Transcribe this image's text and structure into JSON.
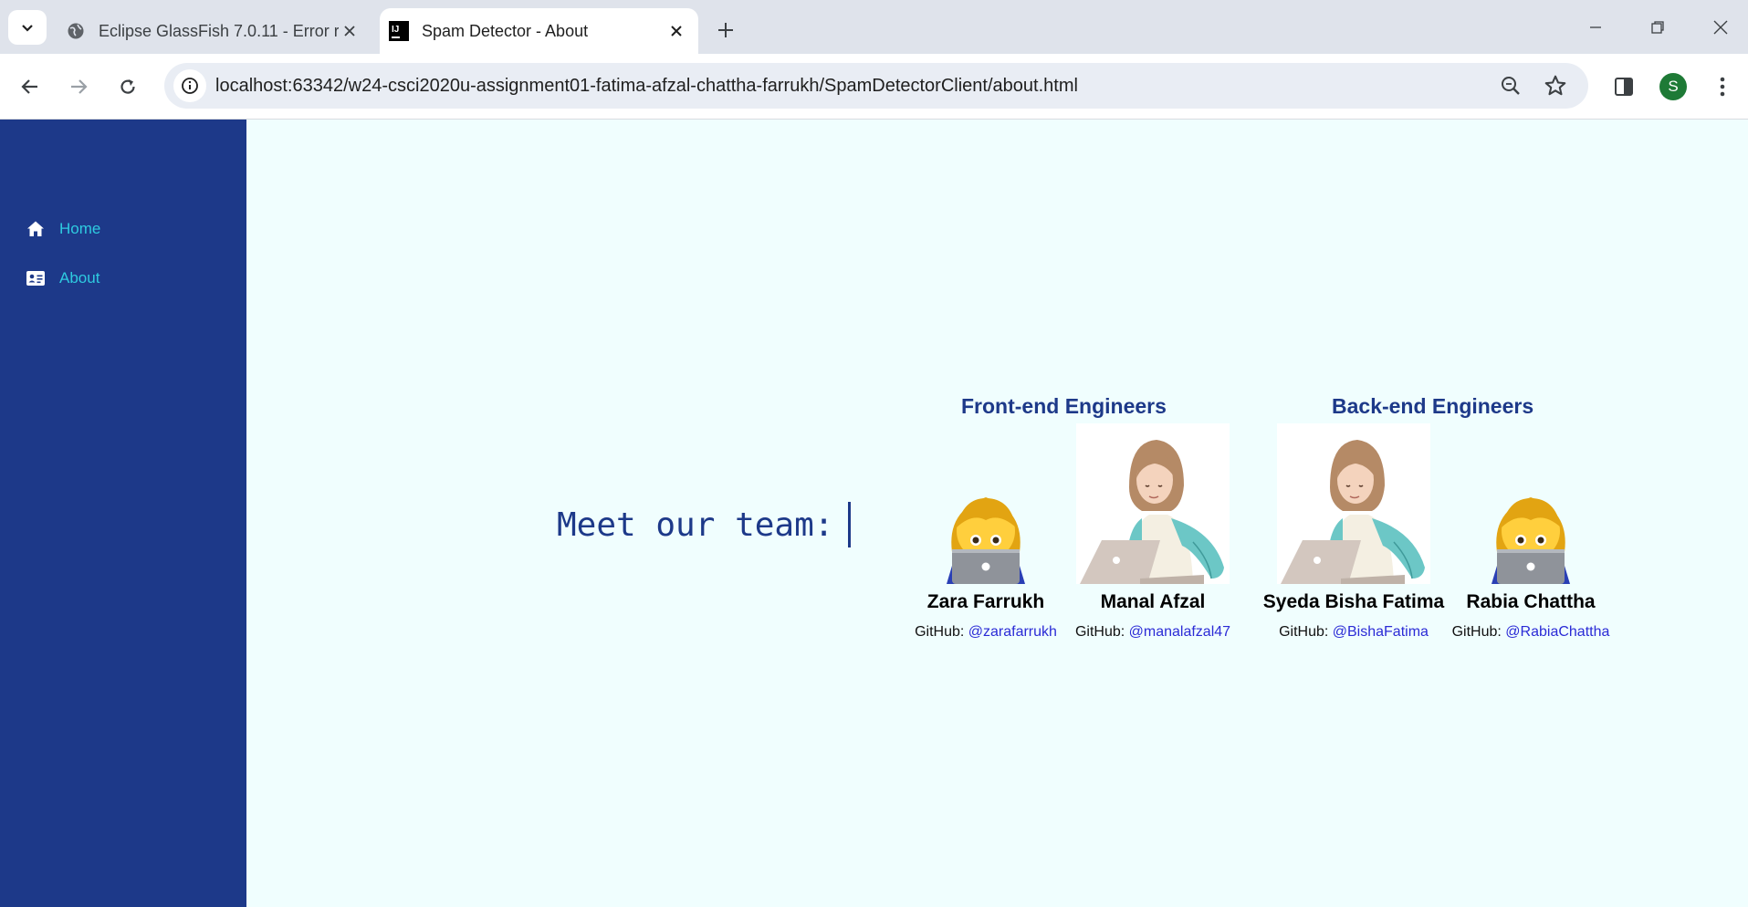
{
  "browser": {
    "tabs": [
      {
        "title": "Eclipse GlassFish 7.0.11 - Error r",
        "favicon": "globe-icon",
        "active": false
      },
      {
        "title": "Spam Detector - About",
        "favicon": "intellij-icon",
        "active": true
      }
    ],
    "url": "localhost:63342/w24-csci2020u-assignment01-fatima-afzal-chattha-farrukh/SpamDetectorClient/about.html",
    "profile_initial": "S"
  },
  "sidebar": {
    "items": [
      {
        "label": "Home",
        "icon": "home-icon"
      },
      {
        "label": "About",
        "icon": "id-card-icon"
      }
    ]
  },
  "main": {
    "heading": "Meet our team:",
    "groups": [
      {
        "title": "Front-end Engineers"
      },
      {
        "title": "Back-end Engineers"
      }
    ],
    "members": [
      {
        "name": "Zara Farrukh",
        "github_prefix": "GitHub:",
        "github": "@zarafarrukh",
        "avatar": "woman-technologist-emoji"
      },
      {
        "name": "Manal Afzal",
        "github_prefix": "GitHub:",
        "github": "@manalafzal47",
        "avatar": "hijab-woman-laptop-illustration"
      },
      {
        "name": "Syeda Bisha Fatima",
        "github_prefix": "GitHub:",
        "github": "@BishaFatima",
        "avatar": "hijab-woman-laptop-illustration"
      },
      {
        "name": "Rabia Chattha",
        "github_prefix": "GitHub:",
        "github": "@RabiaChattha",
        "avatar": "woman-technologist-emoji"
      }
    ]
  },
  "colors": {
    "sidebar": "#1d3989",
    "nav_link": "#2ecbe0",
    "page_bg": "#f0fefe",
    "heading": "#1d3989",
    "link": "#2b2bd6"
  }
}
